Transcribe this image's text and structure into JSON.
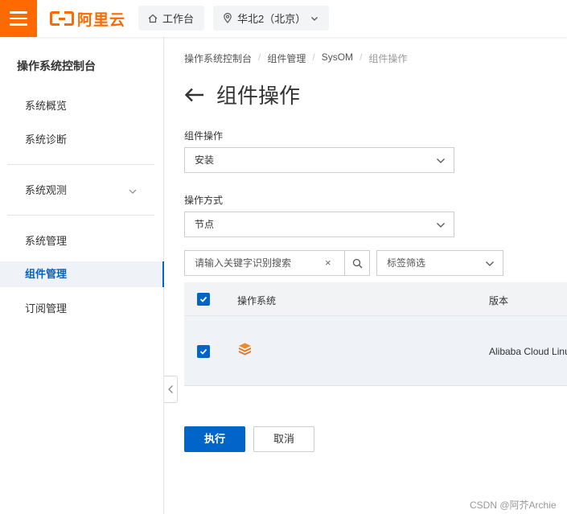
{
  "topbar": {
    "logo_text": "阿里云",
    "workbench_label": "工作台",
    "region_label": "华北2（北京）",
    "brand_color": "#ff6a00"
  },
  "sidebar": {
    "title": "操作系统控制台",
    "items": [
      {
        "label": "系统概览"
      },
      {
        "label": "系统诊断"
      },
      {
        "label": "系统观测"
      },
      {
        "label": "系统管理"
      },
      {
        "label": "组件管理"
      },
      {
        "label": "订阅管理"
      }
    ],
    "active_item": "组件管理",
    "accent_color": "#0064c8"
  },
  "breadcrumb": [
    "操作系统控制台",
    "组件管理",
    "SysOM",
    "组件操作"
  ],
  "page": {
    "title": "组件操作"
  },
  "form": {
    "operation_label": "组件操作",
    "operation_value": "安装",
    "method_label": "操作方式",
    "method_value": "节点",
    "search_placeholder": "请输入关键字识别搜索",
    "search_clear": "×",
    "tag_filter_label": "标签筛选"
  },
  "table": {
    "columns": [
      "操作系统",
      "版本"
    ],
    "rows": [
      {
        "checked": true,
        "os_icon": "cube-icon",
        "version": "Alibaba Cloud Linux"
      }
    ],
    "header_checked": true
  },
  "actions": {
    "execute_label": "执行",
    "cancel_label": "取消"
  },
  "watermark": "CSDN @阿芥Archie"
}
